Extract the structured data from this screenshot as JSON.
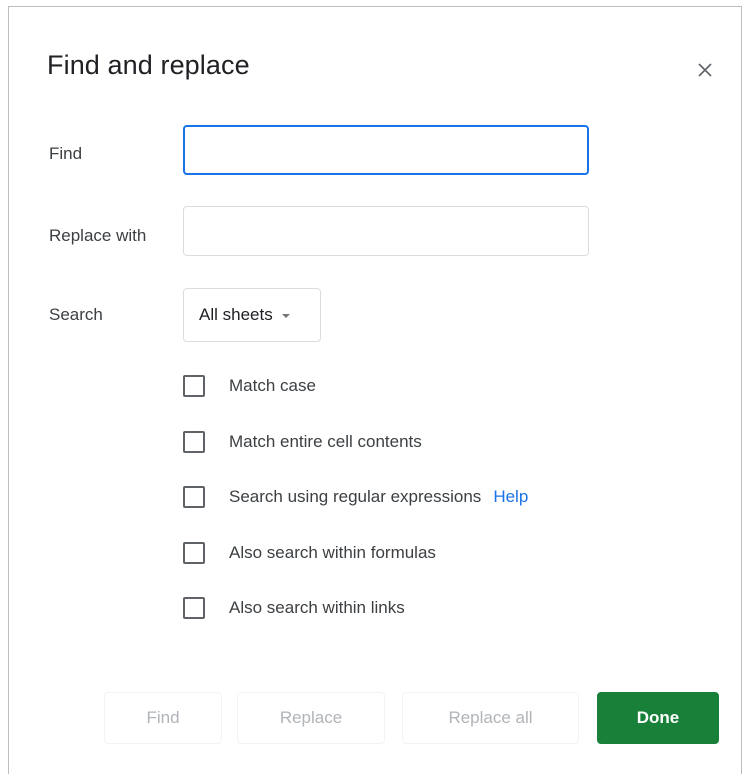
{
  "dialog": {
    "title": "Find and replace",
    "close_icon": "close-icon"
  },
  "fields": {
    "find_label": "Find",
    "find_value": "",
    "replace_label": "Replace with",
    "replace_value": "",
    "search_label": "Search",
    "search_scope": "All sheets"
  },
  "options": [
    {
      "label": "Match case",
      "checked": false
    },
    {
      "label": "Match entire cell contents",
      "checked": false
    },
    {
      "label": "Search using regular expressions",
      "checked": false,
      "link": "Help"
    },
    {
      "label": "Also search within formulas",
      "checked": false
    },
    {
      "label": "Also search within links",
      "checked": false
    }
  ],
  "buttons": {
    "find": "Find",
    "replace": "Replace",
    "replace_all": "Replace all",
    "done": "Done"
  },
  "colors": {
    "accent_blue": "#1a73e8",
    "done_green": "#188038",
    "disabled_text": "#b0b4b8"
  }
}
